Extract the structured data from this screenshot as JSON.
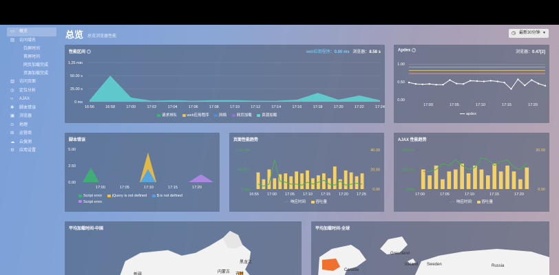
{
  "sidebar": {
    "items": [
      {
        "label": "概览",
        "icon": "monitor-icon"
      },
      {
        "label": "访问域名",
        "icon": "document-icon"
      }
    ],
    "sub_items": [
      "白屏时间",
      "首屏时间",
      "网页加载完成",
      "资源加载完成"
    ],
    "items2": [
      {
        "label": "访问页面",
        "icon": "page-icon"
      },
      {
        "label": "定位分析",
        "icon": "target-icon"
      },
      {
        "label": "AJAX",
        "icon": "code-icon"
      },
      {
        "label": "脚本错误",
        "icon": "bug-icon"
      },
      {
        "label": "浏览器",
        "icon": "browser-icon"
      },
      {
        "label": "地理",
        "icon": "location-icon"
      },
      {
        "label": "运营商",
        "icon": "network-icon"
      },
      {
        "label": "云拨测",
        "icon": "cloud-icon"
      },
      {
        "label": "应用设置",
        "icon": "settings-icon"
      }
    ]
  },
  "header": {
    "title": "总览",
    "subtitle": "总览浏览器性能",
    "range_label": "最新30分钟"
  },
  "perf": {
    "title": "性能区间",
    "meta_a": "web应用程序：",
    "meta_a_val": "0.00 ms",
    "meta_b": "浏览器：",
    "meta_b_val": "8.58 s",
    "legend": [
      "请求排队",
      "web应用程序",
      "网络",
      "网页加载",
      "资源加载"
    ]
  },
  "apdex": {
    "title": "Apdex",
    "meta": "浏览器：",
    "meta_val": "0.47[2]",
    "legend": "apdex"
  },
  "script_err": {
    "title": "脚本错误",
    "legend": [
      "Script error",
      "jQuery is not defined",
      "$ is not defined",
      "Script error."
    ]
  },
  "page_trend": {
    "title": "页面性能趋势",
    "legend": [
      "响应时间",
      "吞吐量"
    ]
  },
  "ajax_trend": {
    "title": "AJAX 性能趋势",
    "legend": [
      "响应时间",
      "吞吐量"
    ]
  },
  "map_cn": {
    "title": "平均加载时间-中国",
    "labels": [
      "黑龙江",
      "内蒙古",
      "吉林",
      "新疆"
    ]
  },
  "map_world": {
    "title": "平均加载时间-全球",
    "labels": [
      "Greenland",
      "Iceland",
      "Sweden",
      "Russia",
      "Canada"
    ]
  },
  "colors": {
    "queue": "#3cb371",
    "webapp": "#f0c040",
    "network": "#4a90e2",
    "pageload": "#9370db",
    "resource": "#5fd6d6",
    "throughput": "#f3d26b",
    "response": "#4caf50",
    "apdex_line": "#ffffff"
  },
  "chart_data": [
    {
      "type": "area",
      "title": "性能区间",
      "x": [
        "16:56",
        "16:58",
        "17:00",
        "17:02",
        "17:04",
        "17:06",
        "17:08",
        "17:10",
        "17:12",
        "17:14",
        "17:16",
        "17:18",
        "17:20",
        "17:22",
        "17:24"
      ],
      "y_ticks": [
        "0 ms",
        "25.00 s",
        "50.00 s",
        "1.25 min"
      ],
      "ylim": [
        0,
        75
      ],
      "series": [
        {
          "name": "资源加载",
          "values": [
            3,
            50,
            8,
            2,
            3,
            2,
            3,
            3,
            2,
            2,
            4,
            17,
            4,
            12,
            3
          ]
        }
      ]
    },
    {
      "type": "line",
      "title": "Apdex",
      "x": [
        "17:00",
        "17:05",
        "17:10",
        "17:15",
        "17:20"
      ],
      "y_ticks": [
        "0.00",
        "0.50",
        "1.00"
      ],
      "ylim": [
        0,
        1
      ],
      "series": [
        {
          "name": "apdex",
          "values": [
            0.48,
            0.44,
            0.43,
            0.44,
            0.42,
            0.42,
            0.55,
            0.45,
            0.44,
            0.53,
            0.52,
            0.51,
            0.53,
            0.51,
            0.48,
            0.3,
            0.57,
            0.4,
            0.55,
            0.45,
            0.39
          ]
        }
      ]
    },
    {
      "type": "area",
      "title": "脚本错误",
      "x": [
        "17:00",
        "17:05",
        "17:10",
        "17:15",
        "17:20"
      ],
      "y_ticks": [
        "0.00",
        "2.50",
        "5.00"
      ],
      "ylim": [
        0,
        5
      ],
      "series": [
        {
          "name": "Script error",
          "values": [
            2.2
          ]
        },
        {
          "name": "jQuery is not defined",
          "values": [
            4.5
          ]
        },
        {
          "name": "$ is not defined",
          "values": [
            2.0
          ]
        },
        {
          "name": "Script error.",
          "values": [
            1.2
          ]
        }
      ]
    },
    {
      "type": "bar",
      "title": "页面性能趋势",
      "x": [
        "16:55",
        "17:00",
        "17:05",
        "17:10",
        "17:15",
        "17:20",
        "17:25"
      ],
      "y_left_ticks": [
        "0 ms",
        "40.00 s",
        "1.33 min"
      ],
      "y_right_ticks": [
        "0.00",
        "20.00",
        "40.00"
      ],
      "series": [
        {
          "name": "吞吐量",
          "values": [
            17,
            10,
            20,
            11,
            15,
            16,
            13,
            18,
            16,
            19,
            11,
            14,
            16,
            11,
            23,
            10,
            19,
            17,
            13,
            16
          ]
        },
        {
          "name": "响应时间",
          "values": [
            5,
            3,
            5,
            30,
            8,
            7,
            5,
            5,
            4,
            7,
            5,
            7,
            9,
            5,
            4,
            8,
            4,
            5,
            6,
            5
          ]
        }
      ]
    },
    {
      "type": "bar",
      "title": "AJAX 性能趋势",
      "x": [
        "17:00",
        "17:05",
        "17:10",
        "17:15",
        "17:20"
      ],
      "y_left_ticks": [
        "0 ms",
        "200 ms",
        "400 ms"
      ],
      "y_right_ticks": [
        "0.00",
        "20.00"
      ],
      "series": [
        {
          "name": "吞吐量",
          "values": [
            10,
            7,
            12,
            5,
            9,
            10,
            13,
            8,
            12,
            10,
            7,
            13,
            9,
            12,
            9,
            5,
            11
          ]
        },
        {
          "name": "响应时间",
          "values": [
            9,
            9,
            10,
            13,
            12,
            15,
            12,
            10,
            11,
            16,
            15,
            12,
            14,
            15,
            11,
            10,
            13
          ]
        }
      ]
    }
  ]
}
